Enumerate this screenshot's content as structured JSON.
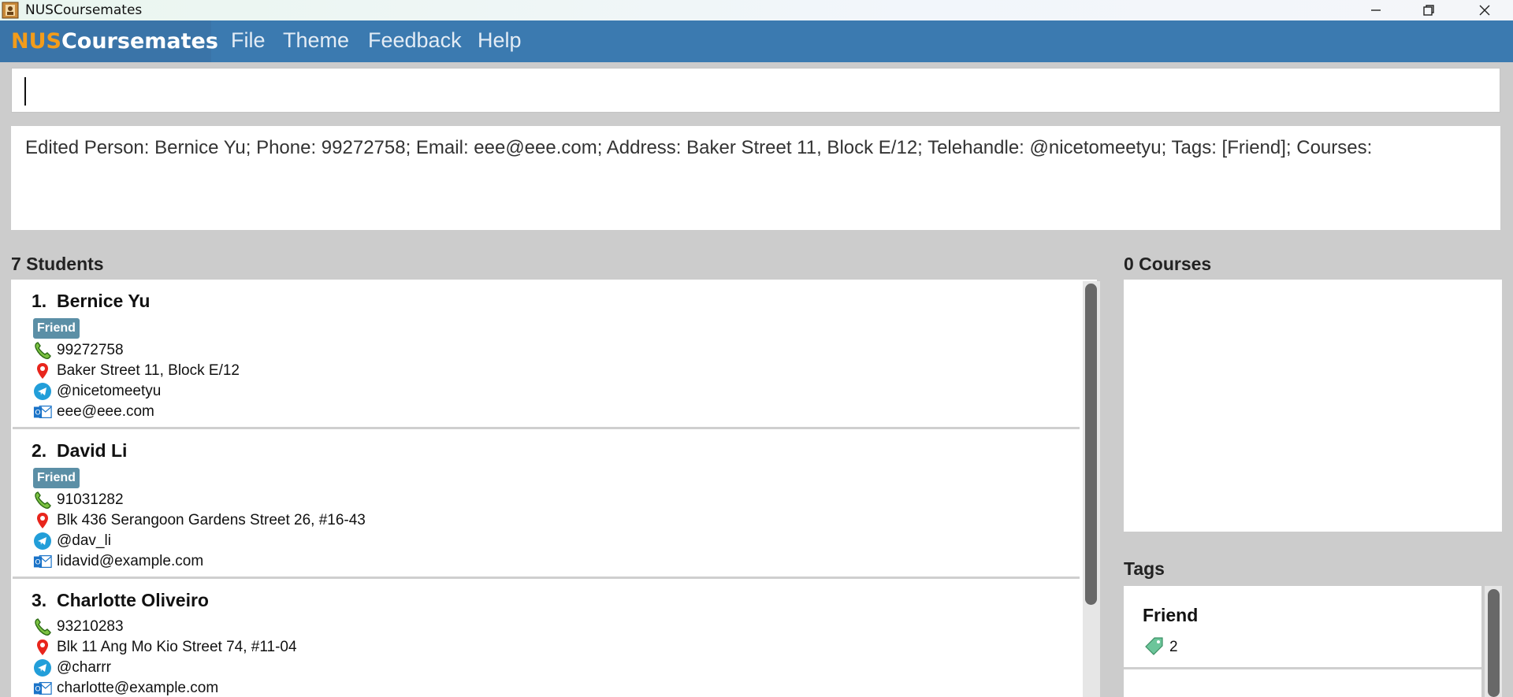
{
  "window": {
    "title": "NUSCoursemates"
  },
  "menubar": {
    "logo_part1": "NUS",
    "logo_part2": "Coursemates",
    "items": [
      "File",
      "Theme",
      "Feedback",
      "Help"
    ]
  },
  "command": {
    "value": "",
    "placeholder": ""
  },
  "result": {
    "text": "Edited Person: Bernice Yu; Phone: 99272758; Email: eee@eee.com; Address: Baker Street 11, Block E/12; Telehandle: @nicetomeetyu; Tags: [Friend]; Courses:"
  },
  "students": {
    "header": "7 Students",
    "list": [
      {
        "index": "1.",
        "name": "Bernice Yu",
        "tag": "Friend",
        "phone": "99272758",
        "address": "Baker Street 11, Block E/12",
        "telehandle": "@nicetomeetyu",
        "email": "eee@eee.com"
      },
      {
        "index": "2.",
        "name": "David Li",
        "tag": "Friend",
        "phone": "91031282",
        "address": "Blk 436 Serangoon Gardens Street 26, #16-43",
        "telehandle": "@dav_li",
        "email": "lidavid@example.com"
      },
      {
        "index": "3.",
        "name": "Charlotte Oliveiro",
        "tag": "",
        "phone": "93210283",
        "address": "Blk 11 Ang Mo Kio Street 74, #11-04",
        "telehandle": "@charrr",
        "email": "charlotte@example.com"
      }
    ]
  },
  "courses": {
    "header": "0 Courses"
  },
  "tags": {
    "header": "Tags",
    "list": [
      {
        "name": "Friend",
        "count": "2"
      }
    ]
  },
  "colors": {
    "menubar": "#3b7ab0",
    "logo_accent": "#f39c1a",
    "tag_bg": "#5b8fa6",
    "background": "#cccccc"
  }
}
